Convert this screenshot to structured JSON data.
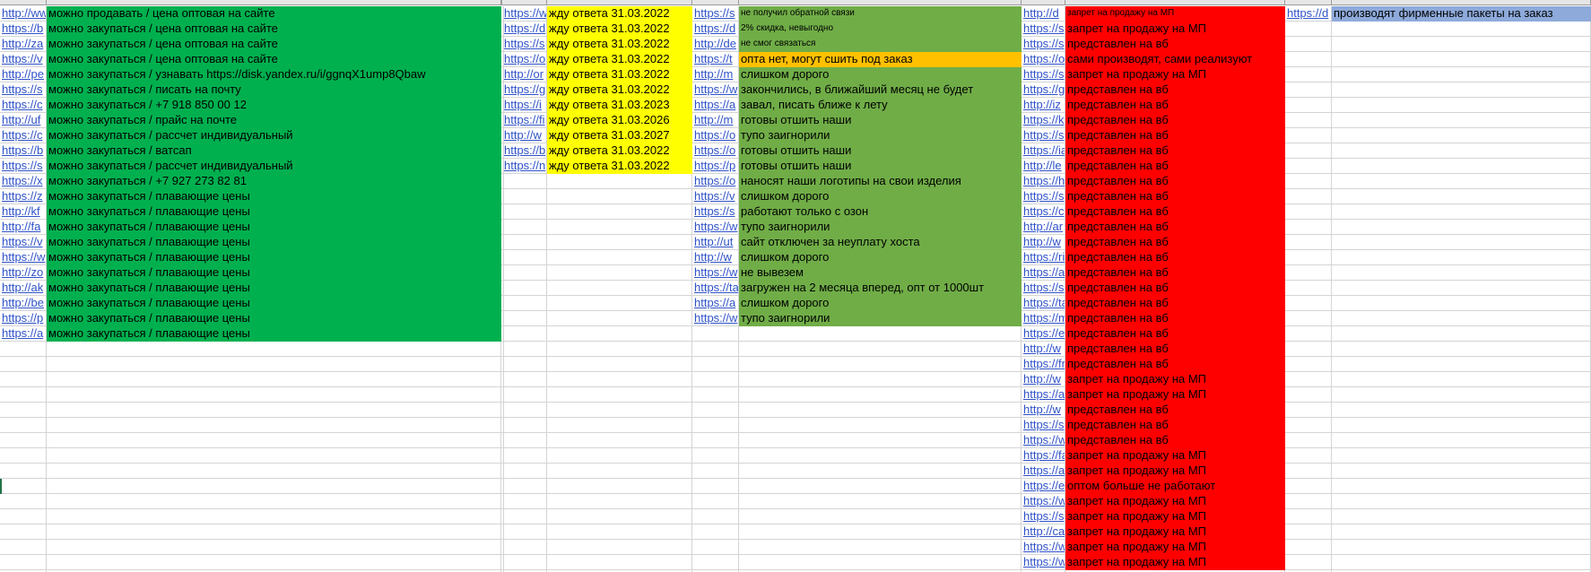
{
  "colors": {
    "green": "#00b04f",
    "yellow": "#ffff00",
    "olive": "#70ad47",
    "orange": "#ffc000",
    "red": "#ff0000",
    "blue": "#8eaadb",
    "link": "#2f52c8",
    "gridline": "#d4d4d4"
  },
  "sheet": {
    "rows": [
      {
        "a": "http://ww",
        "b": "можно продавать / цена оптовая на сайте",
        "d": "https://w",
        "e": "жду ответа 31.03.2022",
        "f": "https://s",
        "g": "не получил обратной связи",
        "h": "http://d",
        "i": "запрет на продажу на МП",
        "j": "https://d",
        "k": "производят фирменные пакеты на заказ"
      },
      {
        "a": "https://b",
        "b": "можно закупаться / цена оптовая на сайте",
        "d": "https://d",
        "e": "жду ответа 31.03.2022",
        "f": "https://d",
        "g": "2% скидка, невыгодно",
        "h": "https://s",
        "i": "запрет на продажу на МП"
      },
      {
        "a": "http://za",
        "b": "можно закупаться / цена оптовая на сайте",
        "d": "https://s",
        "e": "жду ответа 31.03.2022",
        "f": "http://de",
        "g": "не смог связаться",
        "h": "https://s",
        "i": "представлен на вб"
      },
      {
        "a": "https://v",
        "b": "можно закупаться / цена оптовая на сайте",
        "d": "https://o",
        "e": "жду ответа 31.03.2022",
        "f": "https://t",
        "g": "опта нет, могут сшить под заказ",
        "h": "https://o",
        "i": "сами производят, сами реализуют"
      },
      {
        "a": "http://pe",
        "b": "можно закупаться / узнавать https://disk.yandex.ru/i/ggnqX1ump8Qbaw",
        "d": "http://or",
        "e": "жду ответа 31.03.2022",
        "f": "http://m",
        "g": "слишком дорого",
        "h": "https://s",
        "i": "запрет на продажу на МП"
      },
      {
        "a": "https://s",
        "b": "можно закупаться / писать на почту",
        "d": "https://g",
        "e": "жду ответа 31.03.2022",
        "f": "https://w",
        "g": "закончились, в ближайший месяц не будет",
        "h": "https://g",
        "i": "представлен на вб"
      },
      {
        "a": "https://c",
        "b": "можно закупаться / +7 918 850 00 12",
        "d": "https://i",
        "e": "жду ответа 31.03.2023",
        "f": "https://a",
        "g": "завал, писать ближе к лету",
        "h": "http://iz",
        "i": "представлен на вб"
      },
      {
        "a": "http://uf",
        "b": "можно закупаться / прайс на почте",
        "d": "https://fi",
        "e": "жду ответа 31.03.2026",
        "f": "http://m",
        "g": "готовы отшить наши",
        "h": "https://k",
        "i": "представлен на вб"
      },
      {
        "a": "https://c",
        "b": "можно закупаться / рассчет индивидуальный",
        "d": "http://w",
        "e": "жду ответа 31.03.2027",
        "f": "https://o",
        "g": "тупо заигнорили",
        "h": "https://s",
        "i": "представлен на вб"
      },
      {
        "a": "https://b",
        "b": "можно закупаться / ватсап",
        "d": "https://b",
        "e": "жду ответа 31.03.2022",
        "f": "https://o",
        "g": "готовы отшить наши",
        "h": "https://ia",
        "i": "представлен на вб"
      },
      {
        "a": "https://s",
        "b": "можно закупаться / рассчет индивидуальный",
        "d": "https://n",
        "e": "жду ответа 31.03.2022",
        "f": "https://p",
        "g": "готовы отшить наши",
        "h": "http://le",
        "i": "представлен на вб"
      },
      {
        "a": "https://x",
        "b": "можно закупаться / +7 927 273 82 81",
        "d": "",
        "e": "",
        "f": "https://o",
        "g": "наносят наши логотипы на свои изделия",
        "h": "https://h",
        "i": "представлен на вб"
      },
      {
        "a": "https://z",
        "b": "можно закупаться / плавающие цены",
        "d": "",
        "e": "",
        "f": "https://v",
        "g": "слишком дорого",
        "h": "https://s",
        "i": "представлен на вб"
      },
      {
        "a": "http://kf",
        "b": "можно закупаться / плавающие цены",
        "d": "",
        "e": "",
        "f": "https://s",
        "g": "работают только с озон",
        "h": "https://c",
        "i": "представлен на вб"
      },
      {
        "a": "http://fa",
        "b": "можно закупаться / плавающие цены",
        "d": "",
        "e": "",
        "f": "https://w",
        "g": "тупо заигнорили",
        "h": "http://ar",
        "i": "представлен на вб"
      },
      {
        "a": "https://v",
        "b": "можно закупаться / плавающие цены",
        "d": "",
        "e": "",
        "f": "http://ut",
        "g": "сайт отключен за неуплату хоста",
        "h": "http://w",
        "i": "представлен на вб"
      },
      {
        "a": "https://w",
        "b": "можно закупаться / плавающие цены",
        "d": "",
        "e": "",
        "f": "http://w",
        "g": "слишком дорого",
        "h": "https://ri",
        "i": "представлен на вб"
      },
      {
        "a": "http://zo",
        "b": "можно закупаться / плавающие цены",
        "d": "",
        "e": "",
        "f": "https://w",
        "g": "не вывезем",
        "h": "https://a",
        "i": "представлен на вб"
      },
      {
        "a": "http://ak",
        "b": "можно закупаться / плавающие цены",
        "d": "",
        "e": "",
        "f": "https://ta",
        "g": "загружен на 2 месяца вперед, опт от 1000шт",
        "h": "https://s",
        "i": "представлен на вб"
      },
      {
        "a": "http://be",
        "b": "можно закупаться / плавающие цены",
        "d": "",
        "e": "",
        "f": "https://a",
        "g": "слишком дорого",
        "h": "https://ta",
        "i": "представлен на вб"
      },
      {
        "a": "https://p",
        "b": "можно закупаться / плавающие цены",
        "d": "",
        "e": "",
        "f": "https://w",
        "g": "тупо заигнорили",
        "h": "https://m",
        "i": "представлен на вб"
      },
      {
        "a": "https://a",
        "b": "можно закупаться / плавающие цены",
        "h": "https://e",
        "i": "представлен на вб"
      },
      {
        "h": "http://w",
        "i": "представлен на вб"
      },
      {
        "h": "https://fr",
        "i": "представлен на вб"
      },
      {
        "h": "http://w",
        "i": "запрет на продажу на МП"
      },
      {
        "h": "https://a",
        "i": "запрет на продажу на МП"
      },
      {
        "h": "http://w",
        "i": "представлен на вб"
      },
      {
        "h": "https://s",
        "i": "представлен на вб"
      },
      {
        "h": "https://w",
        "i": "представлен на вб"
      },
      {
        "h": "https://fa",
        "i": "запрет на продажу на МП"
      },
      {
        "h": "https://a",
        "i": "запрет на продажу на МП"
      },
      {
        "h": "https://e",
        "i": "оптом больше не работают"
      },
      {
        "h": "https://w",
        "i": "запрет на продажу на МП"
      },
      {
        "h": "https://s",
        "i": "запрет на продажу на МП"
      },
      {
        "h": "http://ca",
        "i": "запрет на продажу на МП"
      },
      {
        "h": "https://w",
        "i": "запрет на продажу на МП"
      },
      {
        "h": "https://w",
        "i": "запрет на продажу на МП"
      }
    ]
  }
}
